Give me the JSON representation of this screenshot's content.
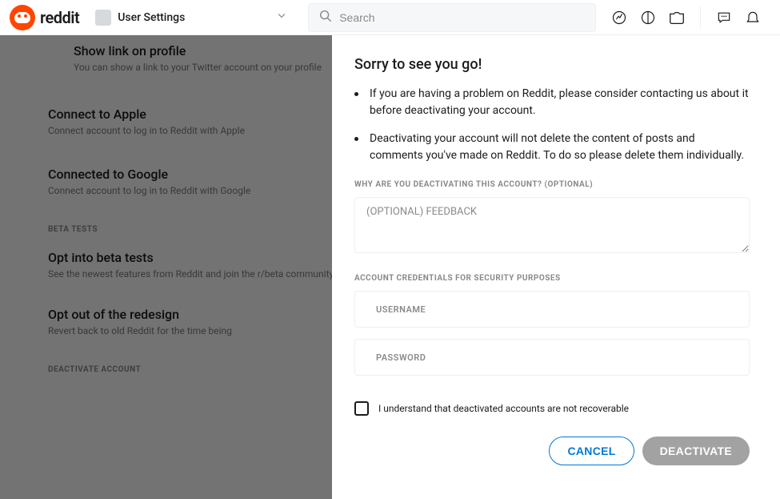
{
  "header": {
    "brand": "reddit",
    "breadcrumb": "User Settings",
    "search_placeholder": "Search"
  },
  "settings": {
    "items": [
      {
        "title": "Show link on profile",
        "desc": "You can show a link to your Twitter account on your profile"
      },
      {
        "title": "Connect to Apple",
        "desc": "Connect account to log in to Reddit with Apple"
      },
      {
        "title": "Connected to Google",
        "desc": "Connect account to log in to Reddit with Google"
      }
    ],
    "beta_header": "BETA TESTS",
    "beta_items": [
      {
        "title": "Opt into beta tests",
        "desc": "See the newest features from Reddit and join the r/beta community"
      },
      {
        "title": "Opt out of the redesign",
        "desc": "Revert back to old Reddit for the time being"
      }
    ],
    "deactivate_header": "DEACTIVATE ACCOUNT"
  },
  "modal": {
    "heading": "Sorry to see you go!",
    "bullets": [
      "If you are having a problem on Reddit, please consider contacting us about it before deactivating your account.",
      "Deactivating your account will not delete the content of posts and comments you've made on Reddit. To do so please delete them individually."
    ],
    "reason_label": "WHY ARE YOU DEACTIVATING THIS ACCOUNT? (OPTIONAL)",
    "feedback_placeholder": "(OPTIONAL) FEEDBACK",
    "creds_label": "ACCOUNT CREDENTIALS FOR SECURITY PURPOSES",
    "username_placeholder": "USERNAME",
    "password_placeholder": "PASSWORD",
    "checkbox_label": "I understand that deactivated accounts are not recoverable",
    "cancel_label": "CANCEL",
    "deactivate_label": "DEACTIVATE"
  }
}
